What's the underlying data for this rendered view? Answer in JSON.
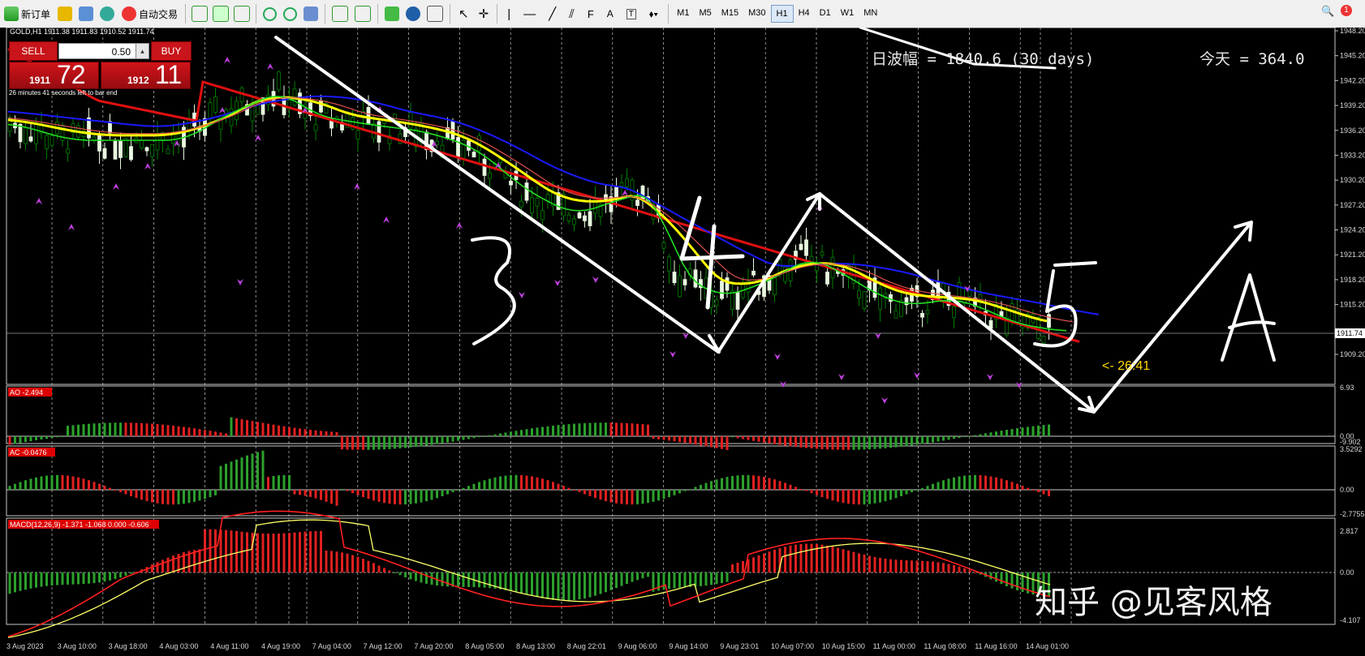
{
  "toolbar": {
    "new_order": "新订单",
    "auto_trading": "自动交易",
    "timeframes": [
      "M1",
      "M5",
      "M15",
      "M30",
      "H1",
      "H4",
      "D1",
      "W1",
      "MN"
    ],
    "active_timeframe": "H1",
    "draw_text_tool": "A",
    "draw_label_tool": "T"
  },
  "chart_header": "GOLD,H1  1911.38 1911.83 1910.52 1911.74",
  "trade_panel": {
    "sell_label": "SELL",
    "buy_label": "BUY",
    "lot": "0.50",
    "sell_small": "1911",
    "sell_big": "72",
    "buy_small": "1912",
    "buy_big": "11",
    "bar_timer": "26 minutes 41 seconds left to bar end"
  },
  "overlay": {
    "range_text": "日波幅 = 1840.6  (30 days)",
    "today_text": "今天 = 364.0",
    "countdown": "<- 26:41",
    "wave_labels": [
      "3",
      "4",
      "5",
      "A"
    ],
    "watermark": "知乎 @见客风格"
  },
  "price_axis": {
    "ticks": [
      "1948.20",
      "1945.20",
      "1942.20",
      "1939.20",
      "1936.20",
      "1933.20",
      "1930.20",
      "1927.20",
      "1924.20",
      "1921.20",
      "1918.20",
      "1915.20",
      "1909.20"
    ],
    "current_price": "1911.74"
  },
  "indicators": {
    "ao": {
      "label": "AO -2.494",
      "ticks": [
        "6.93",
        "0.00",
        "-9.902"
      ]
    },
    "ac": {
      "label": "AC -0.0476",
      "ticks": [
        "3.5292",
        "0.00",
        "-2.7755"
      ]
    },
    "macd": {
      "label": "MACD(12,26,9) -1.371 -1.068 0.000 -0.606",
      "ticks": [
        "2.817",
        "0.00",
        "-4.107"
      ]
    }
  },
  "time_axis": [
    "3 Aug 2023",
    "3 Aug 10:00",
    "3 Aug 18:00",
    "4 Aug 03:00",
    "4 Aug 11:00",
    "4 Aug 19:00",
    "7 Aug 04:00",
    "7 Aug 12:00",
    "7 Aug 20:00",
    "8 Aug 05:00",
    "8 Aug 13:00",
    "8 Aug 22:01",
    "9 Aug 06:00",
    "9 Aug 14:00",
    "9 Aug 23:01",
    "10 Aug 07:00",
    "10 Aug 15:00",
    "11 Aug 00:00",
    "11 Aug 08:00",
    "11 Aug 16:00",
    "14 Aug 01:00"
  ],
  "colors": {
    "bull": "#e8f8e0",
    "bear": "#008000",
    "ma_red": "#e01010",
    "ma_yellow": "#ffff00",
    "ma_blue": "#1a1aff",
    "ma_green": "#22dd22",
    "fractal": "#c040e0",
    "hist_up": "#2ca02c",
    "hist_down": "#e02020",
    "macd_signal": "#ffff66",
    "macd_line": "#ff2020"
  }
}
